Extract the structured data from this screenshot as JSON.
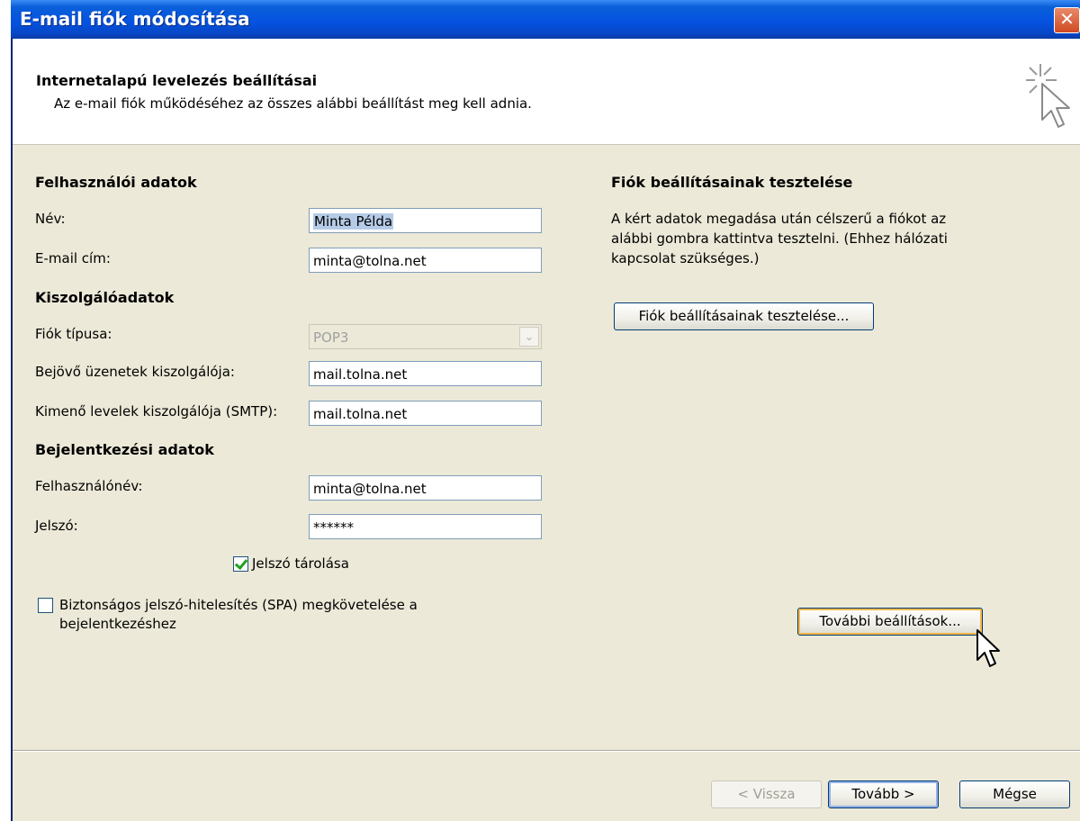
{
  "window": {
    "title": "E-mail fiók módosítása",
    "close": "✕"
  },
  "header": {
    "title": "Internetalapú levelezés beállításai",
    "subtitle": "Az e-mail fiók működéséhez az összes alábbi beállítást meg kell adnia."
  },
  "user": {
    "section": "Felhasználói adatok",
    "name_label": "Név:",
    "name_value": "Minta Példa",
    "email_label": "E-mail cím:",
    "email_value": "minta@tolna.net"
  },
  "server": {
    "section": "Kiszolgálóadatok",
    "type_label": "Fiók típusa:",
    "type_value": "POP3",
    "incoming_label": "Bejövő üzenetek kiszolgálója:",
    "incoming_value": "mail.tolna.net",
    "outgoing_label": "Kimenő levelek kiszolgálója (SMTP):",
    "outgoing_value": "mail.tolna.net"
  },
  "login": {
    "section": "Bejelentkezési adatok",
    "username_label": "Felhasználónév:",
    "username_value": "minta@tolna.net",
    "password_label": "Jelszó:",
    "password_value": "******",
    "remember_label": "Jelszó tárolása",
    "remember_checked": true,
    "spa_label_line1": "Biztonságos jelszó-hitelesítés (SPA) megkövetelése a",
    "spa_label_line2": "bejelentkezéshez",
    "spa_checked": false
  },
  "test": {
    "section": "Fiók beállításainak tesztelése",
    "desc_line1": "A kért adatok megadása után célszerű a fiókot az",
    "desc_line2": "alábbi gombra kattintva tesztelni. (Ehhez hálózati",
    "desc_line3": "kapcsolat szükséges.)",
    "button": "Fiók beállításainak tesztelése..."
  },
  "more_settings": "További beállítások...",
  "footer": {
    "back": "< Vissza",
    "next": "Tovább >",
    "cancel": "Mégse"
  },
  "colors": {
    "titlebar": "#0553e1",
    "dialog": "#ece9d8",
    "field_border": "#7f9db9",
    "hot_border": "#f9b94a"
  }
}
